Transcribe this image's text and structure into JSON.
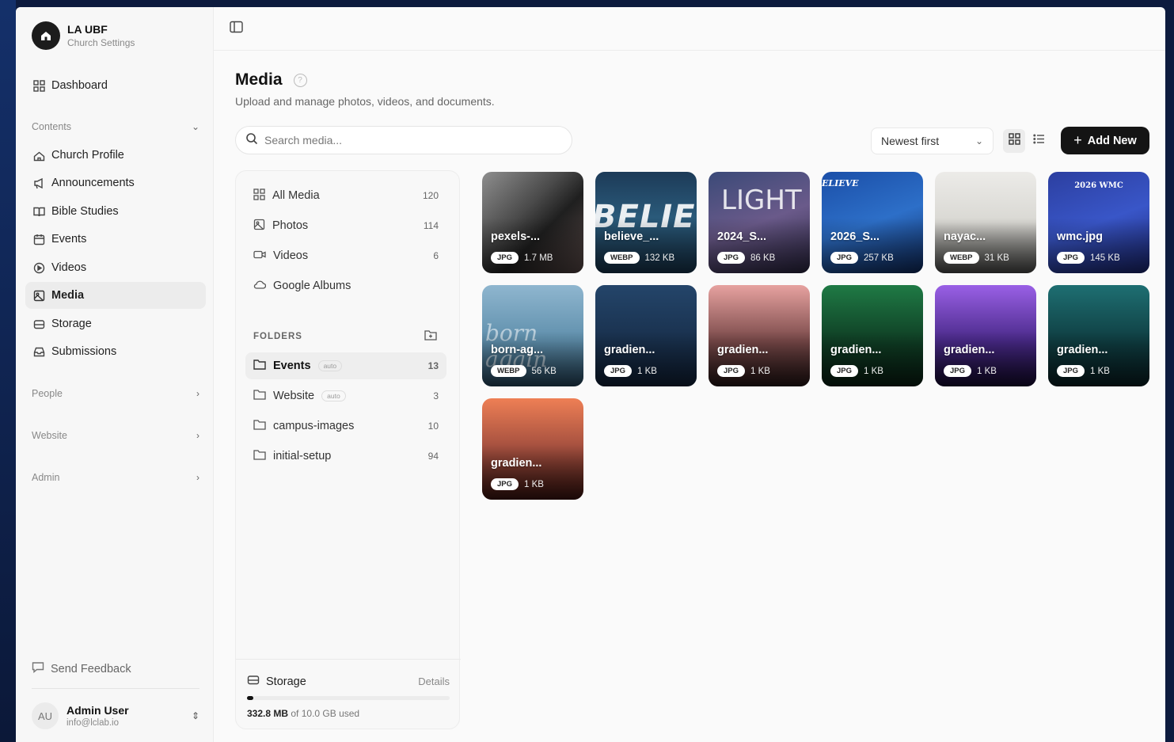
{
  "org": {
    "name": "LA UBF",
    "subtitle": "Church Settings"
  },
  "sidebar": {
    "dashboard": "Dashboard",
    "contents_label": "Contents",
    "contents": [
      {
        "label": "Church Profile",
        "icon": "church-icon"
      },
      {
        "label": "Announcements",
        "icon": "megaphone-icon"
      },
      {
        "label": "Bible Studies",
        "icon": "book-icon"
      },
      {
        "label": "Events",
        "icon": "calendar-icon"
      },
      {
        "label": "Videos",
        "icon": "play-circle-icon"
      },
      {
        "label": "Media",
        "icon": "image-icon",
        "active": true
      },
      {
        "label": "Storage",
        "icon": "storage-icon"
      },
      {
        "label": "Submissions",
        "icon": "inbox-icon"
      }
    ],
    "groups": [
      "People",
      "Website",
      "Admin"
    ],
    "feedback": "Send Feedback",
    "user": {
      "initials": "AU",
      "name": "Admin User",
      "email": "info@lclab.io"
    }
  },
  "page": {
    "title": "Media",
    "subtitle": "Upload and manage photos, videos, and documents.",
    "search_placeholder": "Search media...",
    "sort": "Newest first",
    "add_new": "Add New"
  },
  "library": {
    "items": [
      {
        "label": "All Media",
        "count": "120",
        "icon": "grid-icon"
      },
      {
        "label": "Photos",
        "count": "114",
        "icon": "image-icon"
      },
      {
        "label": "Videos",
        "count": "6",
        "icon": "video-icon"
      },
      {
        "label": "Google Albums",
        "count": "",
        "icon": "cloud-icon"
      }
    ],
    "folders_label": "FOLDERS",
    "folders": [
      {
        "label": "Events",
        "badge": "auto",
        "count": "13",
        "active": true
      },
      {
        "label": "Website",
        "badge": "auto",
        "count": "3"
      },
      {
        "label": "campus-images",
        "badge": "",
        "count": "10"
      },
      {
        "label": "initial-setup",
        "badge": "",
        "count": "94"
      }
    ],
    "storage": {
      "label": "Storage",
      "details": "Details",
      "used": "332.8 MB",
      "suffix": "of 10.0 GB used",
      "fraction": 0.033
    }
  },
  "media": [
    {
      "name": "pexels-...",
      "type": "JPG",
      "size": "1.7 MB",
      "art": "",
      "bg": "linear-gradient(135deg,#8e8e8e 0%,#4a4a4a 40%,#1f1f1f 60%,#5a4a48 100%)"
    },
    {
      "name": "believe_...",
      "type": "WEBP",
      "size": "132 KB",
      "art": "BELIEVE",
      "bg": "linear-gradient(180deg,#1d3b58,#2a5a7a 45%,#18344c)"
    },
    {
      "name": "2024_S...",
      "type": "JPG",
      "size": "86 KB",
      "art": "LIGHT",
      "bg": "linear-gradient(160deg,#3b4a78,#6a5a8a 50%,#2a2540)"
    },
    {
      "name": "2026_S...",
      "type": "JPG",
      "size": "257 KB",
      "art": "ELIEVE",
      "bg": "linear-gradient(160deg,#1b4fa8,#2d6fc8 50%,#0f2a5c)"
    },
    {
      "name": "nayac...",
      "type": "WEBP",
      "size": "31 KB",
      "art": "",
      "bg": "linear-gradient(180deg,#ecebe8,#d9d8d3 50%,#4a4a48)"
    },
    {
      "name": "wmc.jpg",
      "type": "JPG",
      "size": "145 KB",
      "art": "2026 WMC",
      "bg": "linear-gradient(160deg,#2c3fa0,#3956c8 50%,#1b2670)"
    },
    {
      "name": "born-ag...",
      "type": "WEBP",
      "size": "56 KB",
      "art": "born again",
      "bg": "linear-gradient(180deg,#8fb6cf,#5f8fac 55%,#24445a)"
    },
    {
      "name": "gradien...",
      "type": "JPG",
      "size": "1 KB",
      "art": "",
      "bg": "linear-gradient(180deg,#24456a,#102036)"
    },
    {
      "name": "gradien...",
      "type": "JPG",
      "size": "1 KB",
      "art": "",
      "bg": "linear-gradient(180deg,#e7a2a0,#7a4a4a 55%,#251515)"
    },
    {
      "name": "gradien...",
      "type": "JPG",
      "size": "1 KB",
      "art": "",
      "bg": "linear-gradient(180deg,#1f7a45,#0e3a22 60%,#081e12)"
    },
    {
      "name": "gradien...",
      "type": "JPG",
      "size": "1 KB",
      "art": "",
      "bg": "linear-gradient(180deg,#9a60e6,#4a2a8a 55%,#150a30)"
    },
    {
      "name": "gradien...",
      "type": "JPG",
      "size": "1 KB",
      "art": "",
      "bg": "linear-gradient(180deg,#1e6f72,#0e3a3e 60%,#081e22)"
    },
    {
      "name": "gradien...",
      "type": "JPG",
      "size": "1 KB",
      "art": "",
      "bg": "linear-gradient(180deg,#ee7f55,#a24e3e 50%,#3a1410)"
    }
  ]
}
